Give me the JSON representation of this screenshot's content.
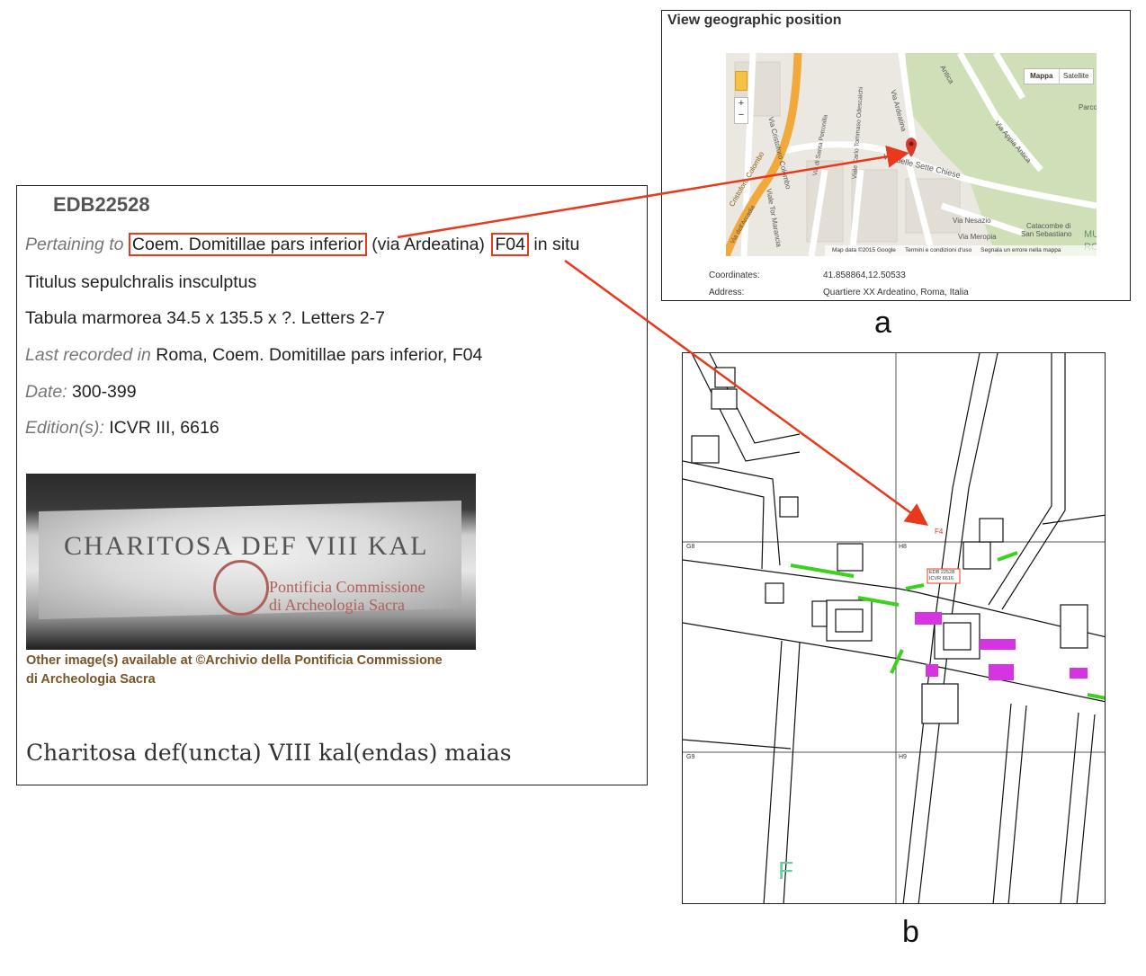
{
  "edb": {
    "record_id": "EDB22528",
    "pertaining_label": "Pertaining to",
    "site_name": "Coem. Domitillae pars inferior",
    "site_road": "(via Ardeatina)",
    "site_code": "F04",
    "in_situ": "in situ",
    "object_type": "Titulus sepulchralis insculptus",
    "support_type": "Tabula marmorea",
    "dimensions": "34.5 x 135.5 x ?.",
    "letters": "Letters 2-7",
    "last_recorded_label": "Last recorded in",
    "last_recorded_value": "Roma, Coem. Domitillae pars inferior, F04",
    "date_label": "Date:",
    "date_value": "300-399",
    "edition_label": "Edition(s):",
    "edition_value": "ICVR III, 6616",
    "photo_inscription": "CHARITOSA  DEF  VIII KAL",
    "photo_watermark_1": "Pontificia Commissione",
    "photo_watermark_2": "di Archeologia Sacra",
    "credit_line_1": "Other image(s) available at ©Archivio della Pontificia Commissione",
    "credit_line_2": "di Archeologia Sacra",
    "transcription": "Charitosa def(uncta) VIII kal(endas) maias"
  },
  "geo": {
    "title": "View geographic position",
    "map_type_active": "Mappa",
    "map_type_other": "Satellite",
    "zoom_in": "+",
    "zoom_out": "−",
    "streets": {
      "cristoforo": "Via Cristoforo Colombo",
      "ardeatina": "Via Ardeatina",
      "antica": "Antica",
      "appia": "Via Appia Antica",
      "parco": "Parco",
      "sette_chiese": "Via delle Sette Chiese",
      "tor_marancia": "Viale Tor Marancia",
      "petronilla": "Via di Santa Petronilla",
      "odescalchi": "Viale Carlo Tommaso Odescalchi",
      "nesazio": "Via Nesazio",
      "meropia": "Via Meropia",
      "catacombe_1": "Catacombe di",
      "catacombe_2": "San Sebastiano",
      "arcadia": "Via dell'Arcadia",
      "colombo_low": "Cristoforo Colombo",
      "fragment_mu": "MU",
      "fragment_ro": "RO"
    },
    "map_footer": {
      "data": "Map data ©2015 Google",
      "terms": "Termini e condizioni d'uso",
      "report": "Segnala un errore nella mappa"
    },
    "coordinates_label": "Coordinates:",
    "coordinates_value": "41.858864,12.50533",
    "address_label": "Address:",
    "address_value": "Quartiere XX Ardeatino, Roma, Italia"
  },
  "plan": {
    "grid_g8": "G8",
    "grid_h8": "H8",
    "grid_g9": "G9",
    "grid_h9": "H9",
    "marker_f4": "F4",
    "label_1": "EDB 22528",
    "label_2": "ICVR 6616",
    "region": "F"
  },
  "panel_letters": {
    "a": "a",
    "b": "b"
  },
  "colors": {
    "highlight_red": "#e8391c",
    "map_marker": "#d93a2b",
    "map_road": "#f2a93b",
    "plan_green": "#39d31e",
    "plan_magenta": "#d535e0"
  }
}
